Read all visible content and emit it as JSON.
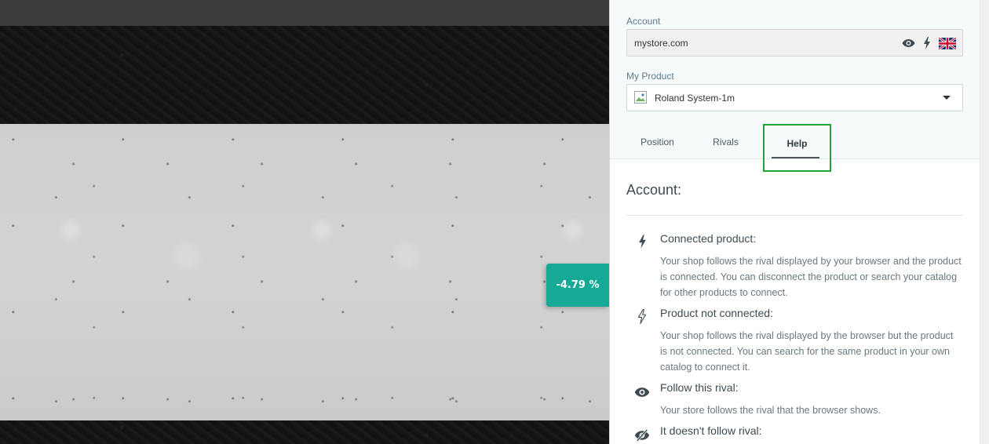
{
  "page": {
    "price_badge": "-4.79 %"
  },
  "panel": {
    "account": {
      "label": "Account",
      "value": "mystore.com",
      "icons": [
        "eye-icon",
        "lightning-icon",
        "uk-flag-icon"
      ]
    },
    "product": {
      "label": "My Product",
      "selected": "Roland System-1m"
    },
    "tabs": [
      {
        "label": "Position"
      },
      {
        "label": "Rivals"
      },
      {
        "label": "Help",
        "active": true
      }
    ],
    "help": {
      "title": "Account:",
      "items": [
        {
          "icon": "lightning-filled-icon",
          "title": "Connected product:",
          "description": "Your shop follows the rival displayed by your browser and the product is connected. You can disconnect the product or search your catalog for other products to connect."
        },
        {
          "icon": "lightning-outline-icon",
          "title": "Product not connected:",
          "description": "Your shop follows the rival displayed by the browser but the product is not connected. You can search for the same product in your own catalog to connect it."
        },
        {
          "icon": "eye-icon",
          "title": "Follow this rival:",
          "description": "Your store follows the rival that the browser shows."
        },
        {
          "icon": "eye-slash-icon",
          "title": "It doesn't follow rival:",
          "description": ""
        }
      ]
    }
  },
  "colors": {
    "badge": "#16a995",
    "highlight": "#21a532",
    "panel_head": "#f6fafb"
  }
}
